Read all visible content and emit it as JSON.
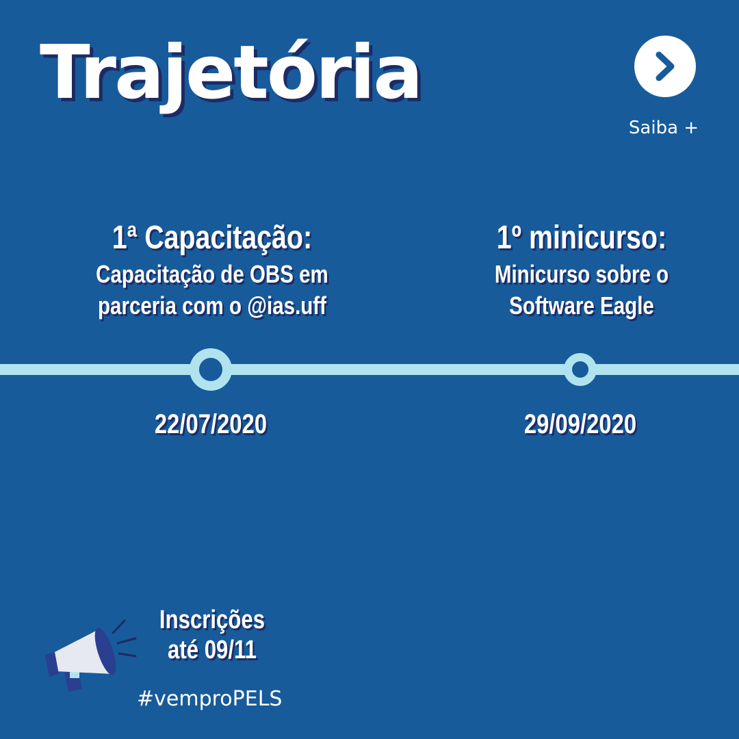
{
  "title": "Trajetória",
  "nav": {
    "next_icon": "chevron-right-icon",
    "saiba_label": "Saiba +"
  },
  "events": [
    {
      "title": "1ª Capacitação:",
      "description_line1": "Capacitação de OBS em",
      "description_line2": "parceria com o @ias.uff",
      "date": "22/07/2020"
    },
    {
      "title": "1º minicurso:",
      "description_line1": "Minicurso sobre o",
      "description_line2": "Software Eagle",
      "date": "29/09/2020"
    }
  ],
  "footer": {
    "icon": "megaphone-icon",
    "inscricoes_line1": "Inscrições",
    "inscricoes_line2": "até 09/11",
    "hashtag": "#vemproPELS"
  },
  "colors": {
    "background": "#175b9b",
    "timeline": "#b1e3ef",
    "shadow": "#1d2b63",
    "text": "#ffffff"
  }
}
